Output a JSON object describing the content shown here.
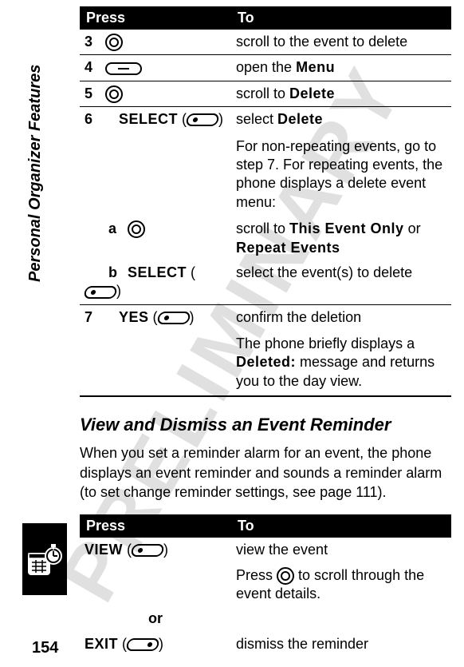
{
  "watermark": "PRELIMINARY",
  "sidebar_label": "Personal Organizer Features",
  "page_number": "154",
  "table1": {
    "head_press": "Press",
    "head_to": "To",
    "rows": {
      "r3": {
        "num": "3",
        "to": "scroll to the event to delete"
      },
      "r4": {
        "num": "4",
        "to_a": "open the ",
        "to_b": "Menu"
      },
      "r5": {
        "num": "5",
        "to_a": "scroll to ",
        "to_b": "Delete"
      },
      "r6": {
        "num": "6",
        "key": "SELECT",
        "to_a": "select ",
        "to_b": "Delete"
      },
      "r6note": "For non-repeating events, go to step 7. For repeating events, the phone displays a delete event menu:",
      "ra": {
        "letter": "a",
        "to_a": "scroll to ",
        "to_b": "This Event Only",
        "to_c": " or ",
        "to_d": "Repeat Events"
      },
      "rb": {
        "letter": "b",
        "key": "SELECT",
        "to": "select the event(s) to delete"
      },
      "r7": {
        "num": "7",
        "key": "YES",
        "to": "confirm the deletion"
      },
      "r7note_a": "The phone briefly displays a ",
      "r7note_b": "Deleted:",
      "r7note_c": " message and returns you to the day view."
    }
  },
  "section_heading": "View and Dismiss an Event Reminder",
  "section_body": "When you set a reminder alarm for an event, the phone displays an event reminder and sounds a reminder alarm (to set change reminder settings, see page 111).",
  "table2": {
    "head_press": "Press",
    "head_to": "To",
    "rows": {
      "rview": {
        "key": "VIEW",
        "to": "view the event"
      },
      "rnote_a": "Press ",
      "rnote_b": " to scroll through the event details.",
      "or": "or",
      "rexit": {
        "key": "EXIT",
        "to": "dismiss the reminder"
      }
    }
  }
}
